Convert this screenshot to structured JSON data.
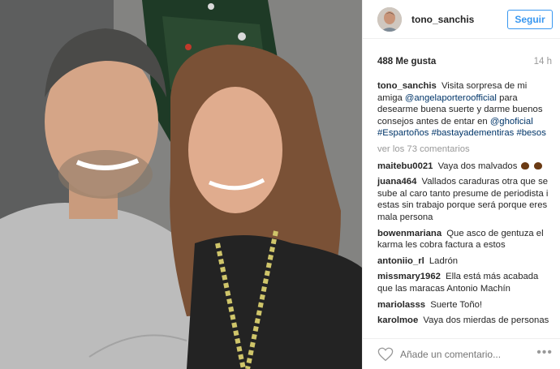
{
  "post": {
    "username": "tono_sanchis",
    "follow_label": "Seguir",
    "likes": "488 Me gusta",
    "time": "14 h",
    "view_more": "ver los 73 comentarios",
    "add_comment_placeholder": "Añade un comentario...",
    "more_icon": "•••"
  },
  "caption": {
    "user": "tono_sanchis",
    "text1": "Visita sorpresa de mi amiga",
    "mention1": "@angelaporteroofficial",
    "text2": "para desearme buena suerte y darme buenos consejos antes de entar en",
    "mention2": "@ghoficial",
    "hashtags": "#Espartoños #bastayadementiras #besos"
  },
  "comments": [
    {
      "user": "maitebu0021",
      "text": "Vaya dos malvados"
    },
    {
      "user": "juana464",
      "text": "Vallados caraduras otra que se sube al caro tanto presume de periodista i estas sin trabajo porque será porque eres mala persona"
    },
    {
      "user": "bowenmariana",
      "text": "Que asco de gentuza el karma les cobra factura a estos"
    },
    {
      "user": "antoniio_rl",
      "text": "Ladrón"
    },
    {
      "user": "missmary1962",
      "text": "Ella está más acabada que las maracas Antonio Machín"
    },
    {
      "user": "mariolasss",
      "text": "Suerte Toño!"
    },
    {
      "user": "karolmoe",
      "text": "Vaya dos mierdas de personas"
    }
  ],
  "icons": {
    "heart": "heart-icon",
    "more": "ellipsis-icon",
    "emoji": "poop-emoji-icon"
  },
  "colors": {
    "accent": "#3897f0",
    "link": "#003569",
    "muted": "#999999",
    "text": "#262626"
  }
}
